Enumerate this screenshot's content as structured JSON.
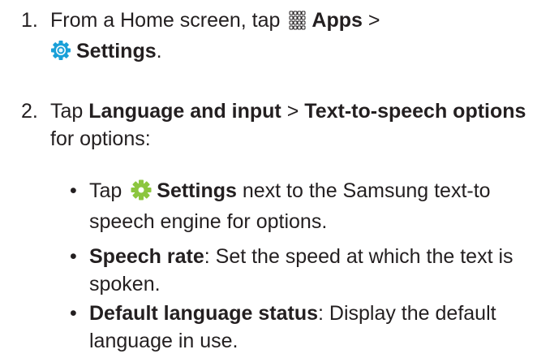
{
  "steps": [
    {
      "number": "1.",
      "text_a": "From a Home screen, tap",
      "apps_label": "Apps",
      "sep": ">",
      "settings_label": "Settings",
      "end": ".",
      "apps_icon": "apps-grid-icon",
      "settings_icon": "settings-gear-icon"
    },
    {
      "number": "2.",
      "text_a": "Tap",
      "language_label": "Language and input",
      "sep": ">",
      "tts_label": "Text-to-speech options",
      "text_b": "for options:"
    }
  ],
  "bullets": [
    {
      "mark": "•",
      "lead": "Tap",
      "bold": "Settings",
      "rest": "next to the Samsung text-to speech engine for options.",
      "icon": "gear-icon"
    },
    {
      "mark": "•",
      "bold": "Speech rate",
      "rest": ": Set the speed at which the text is spoken."
    },
    {
      "mark": "•",
      "bold": "Default language status",
      "rest": ": Display the default language in use."
    }
  ],
  "colors": {
    "text": "#231f20",
    "settings_icon_blue": "#1aa0d8",
    "gear_icon_green": "#8cc63f"
  }
}
